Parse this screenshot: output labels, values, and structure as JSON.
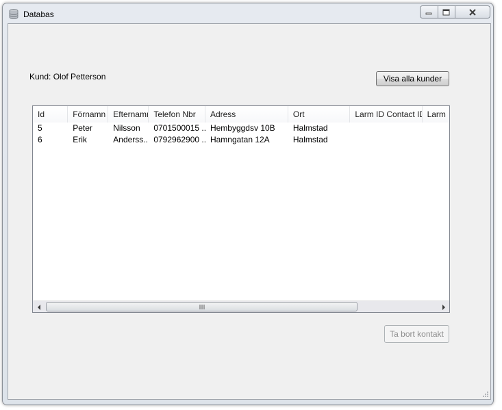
{
  "window": {
    "title": "Databas",
    "icon": "database-icon",
    "caption_buttons": [
      "minimize-icon",
      "maximize-icon",
      "close-icon"
    ]
  },
  "form": {
    "kund_label": "Kund: Olof Petterson",
    "visa_alla_button": "Visa alla kunder",
    "ta_bort_button": "Ta bort kontakt",
    "ta_bort_enabled": false
  },
  "listview": {
    "columns": [
      "Id",
      "Förnamn",
      "Efternamn",
      "Telefon Nbr",
      "Adress",
      "Ort",
      "Larm ID Contact ID",
      "Larm"
    ],
    "rows": [
      [
        "5",
        "Peter",
        "Nilsson",
        "0701500015 ...",
        "Hembyggdsv  10B",
        "Halmstad",
        "",
        ""
      ],
      [
        "6",
        "Erik",
        "Anderss...",
        "0792962900 ...",
        "Hamngatan  12A",
        "Halmstad",
        "",
        ""
      ]
    ],
    "scrollbar": {
      "thumb_grip": "scroll-grip-icon"
    }
  },
  "colors": {
    "window_frame": "#dde3ea",
    "client_bg": "#f0f0f0",
    "disabled_text": "#8d8d8d"
  }
}
